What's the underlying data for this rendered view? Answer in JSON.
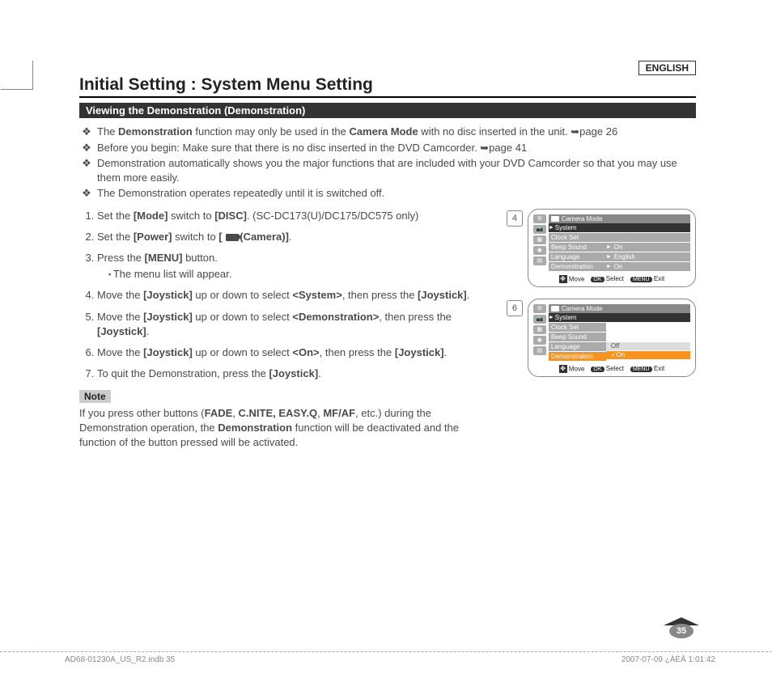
{
  "language_tag": "ENGLISH",
  "title": "Initial Setting : System Menu Setting",
  "section_header": "Viewing the Demonstration (Demonstration)",
  "bullets": {
    "b1_pre": "The ",
    "b1_bold1": "Demonstration",
    "b1_mid": " function may only be used in the ",
    "b1_bold2": "Camera Mode",
    "b1_post": " with no disc inserted in the unit. ➥page 26",
    "b2": "Before you begin: Make sure that there is no disc inserted in the DVD Camcorder. ➥page 41",
    "b3": "Demonstration automatically shows you the major functions that are included with your DVD Camcorder so that you may use them more easily.",
    "b4": "The Demonstration operates repeatedly until it is switched off."
  },
  "steps": {
    "s1_pre": "Set the ",
    "s1_b1": "[Mode]",
    "s1_mid": " switch to ",
    "s1_b2": "[DISC]",
    "s1_post": ". (SC-DC173(U)/DC175/DC575 only)",
    "s2_pre": "Set the ",
    "s2_b1": "[Power]",
    "s2_mid": " switch to ",
    "s2_b2_open": "[ ",
    "s2_b2_close": "(Camera)]",
    "s2_post": ".",
    "s3_pre": "Press the ",
    "s3_b1": "[MENU]",
    "s3_post": " button.",
    "s3_sub": "The menu list will appear.",
    "s4_pre": "Move the ",
    "s4_b1": "[Joystick]",
    "s4_mid": " up or down to select ",
    "s4_b2": "<System>",
    "s4_mid2": ", then press the ",
    "s4_b3": "[Joystick]",
    "s4_post": ".",
    "s5_pre": "Move the ",
    "s5_b1": "[Joystick]",
    "s5_mid": " up or down to select ",
    "s5_b2": "<Demonstration>",
    "s5_mid2": ", then press the ",
    "s5_b3": "[Joystick]",
    "s5_post": ".",
    "s6_pre": "Move the ",
    "s6_b1": "[Joystick]",
    "s6_mid": " up or down to select ",
    "s6_b2": "<On>",
    "s6_mid2": ", then press the ",
    "s6_b3": "[Joystick]",
    "s6_post": ".",
    "s7_pre": "To quit the Demonstration, press the ",
    "s7_b1": "[Joystick]",
    "s7_post": "."
  },
  "note": {
    "label": "Note",
    "text_pre": "If you press other buttons (",
    "text_b1": "FADE",
    "text_sep1": ", ",
    "text_b2": "C.NITE, EASY.Q",
    "text_sep2": ", ",
    "text_b3": "MF/AF",
    "text_mid": ", etc.) during the Demonstration operation, the ",
    "text_b4": "Demonstration",
    "text_post": " function will be deactivated and the function of the button pressed will be activated."
  },
  "screens": {
    "fig4": {
      "num": "4",
      "mode": "Camera Mode",
      "system_label": "System",
      "rows": [
        {
          "lbl": "Clock Set",
          "val": ""
        },
        {
          "lbl": "Beep Sound",
          "val": "On"
        },
        {
          "lbl": "Language",
          "val": "English"
        },
        {
          "lbl": "Demonstration",
          "val": "On"
        }
      ]
    },
    "fig6": {
      "num": "6",
      "mode": "Camera Mode",
      "system_label": "System",
      "rows": [
        {
          "lbl": "Clock Set"
        },
        {
          "lbl": "Beep Sound"
        },
        {
          "lbl": "Language"
        },
        {
          "lbl": "Demonstration",
          "hl": true
        }
      ],
      "options": {
        "off": "Off",
        "on": "On"
      }
    },
    "footer": {
      "move": "Move",
      "select": "Select",
      "exit": "Exit",
      "ok": "OK",
      "menu": "MENU"
    }
  },
  "page_number": "35",
  "footer_left": "AD68-01230A_US_R2.indb   35",
  "footer_right": "2007-07-09   ¿ÀÈÄ 1:01:42"
}
